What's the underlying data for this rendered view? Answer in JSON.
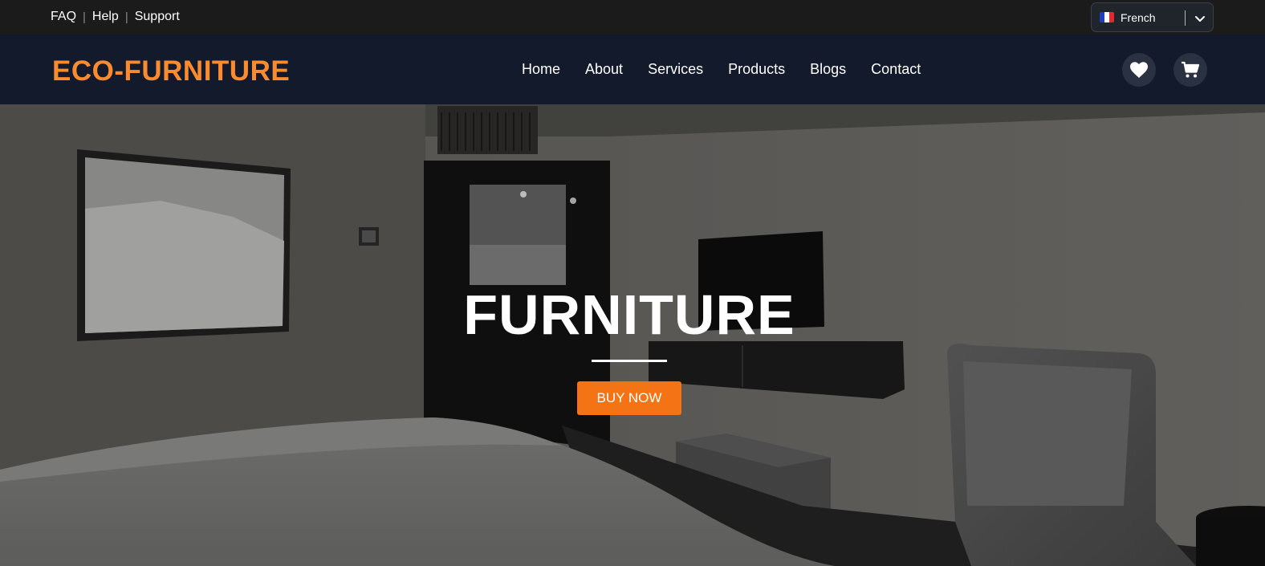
{
  "topbar": {
    "links": [
      "FAQ",
      "Help",
      "Support"
    ],
    "separator": "|",
    "language": {
      "label": "French",
      "flag_icon": "france-flag-icon",
      "flag_colors": [
        "#1f3fbf",
        "#ffffff",
        "#e2292f"
      ]
    }
  },
  "navbar": {
    "logo": "ECO-FURNITURE",
    "items": [
      "Home",
      "About",
      "Services",
      "Products",
      "Blogs",
      "Contact"
    ],
    "icons": [
      "heart-icon",
      "cart-icon"
    ]
  },
  "hero": {
    "title": "FURNITURE",
    "button_label": "BUY NOW"
  },
  "colors": {
    "accent": "#f47314",
    "logo": "#fb8b2f",
    "navbar_bg": "#131a2b",
    "topbar_bg": "#1b1b1b"
  }
}
